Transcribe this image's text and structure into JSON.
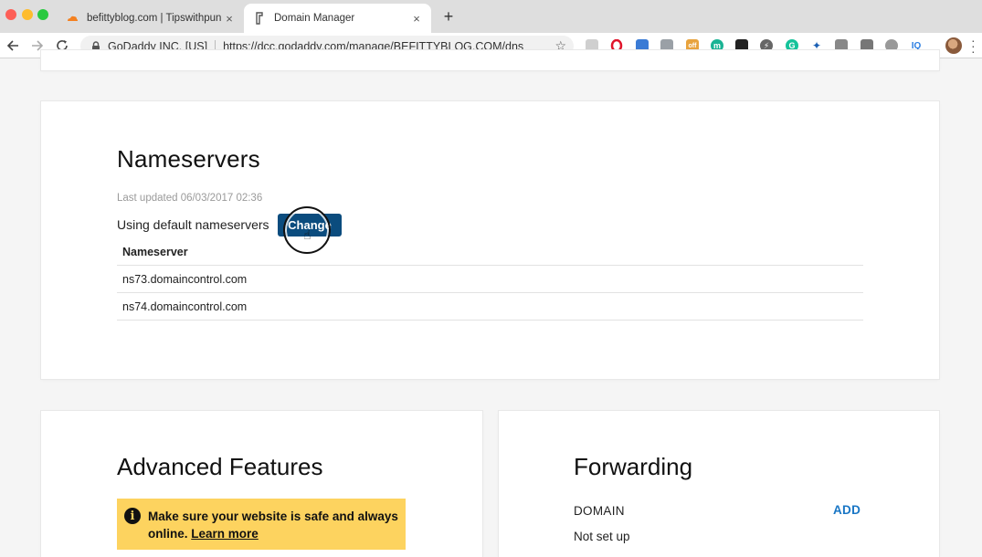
{
  "browser": {
    "tabs": [
      {
        "title": "befittyblog.com | Tipswithpunc",
        "favicon": "cloudflare-icon",
        "active": false
      },
      {
        "title": "Domain Manager",
        "favicon": "godaddy-icon",
        "active": true
      }
    ],
    "new_tab_label": "+",
    "close_glyph": "×",
    "omnibox": {
      "org": "GoDaddy INC. [US]",
      "url_prefix": "https://",
      "url_host": "dcc.godaddy.com",
      "url_path": "/manage/BEFITTYBLOG.COM/dns"
    },
    "extensions": [
      "ghost-icon",
      "opera-icon",
      "tab-icon",
      "screenshot-icon",
      "honey-icon",
      "mercury-icon",
      "window-icon",
      "bolt-icon",
      "grammarly-icon",
      "puzzle-icon",
      "camera-icon",
      "hammer-icon",
      "cat-icon",
      "iq-icon"
    ],
    "extension_iq_label": "IQ",
    "honey_badge": "off"
  },
  "nameservers": {
    "title": "Nameservers",
    "last_updated": "Last updated 06/03/2017 02:36",
    "using_text": "Using default nameservers",
    "change_label": "Change",
    "column_header": "Nameserver",
    "rows": [
      "ns73.domaincontrol.com",
      "ns74.domaincontrol.com"
    ]
  },
  "advanced": {
    "title": "Advanced Features",
    "notice_text": "Make sure your website is safe and always online.",
    "notice_link": "Learn more",
    "info_glyph": "i"
  },
  "forwarding": {
    "title": "Forwarding",
    "domain_label": "DOMAIN",
    "add_label": "ADD",
    "status": "Not set up"
  },
  "colors": {
    "primary_button": "#0b4c7e",
    "link_blue": "#1976c5",
    "notice_yellow": "#fdd35f"
  }
}
